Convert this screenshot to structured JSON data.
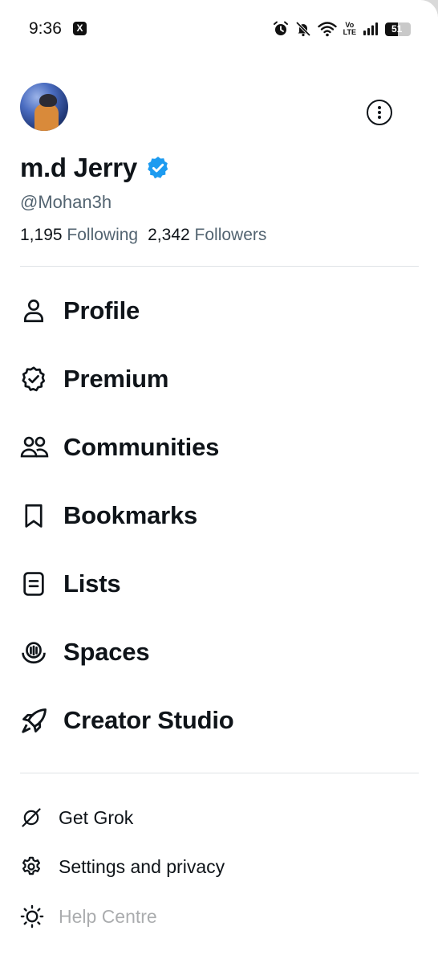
{
  "status_bar": {
    "time": "9:36",
    "app_badge": "X",
    "volte_top": "Vo",
    "volte_bottom": "LTE",
    "battery": "51",
    "battery_level": 0.51
  },
  "profile": {
    "display_name": "m.d Jerry",
    "handle": "@Mohan3h",
    "following_count": "1,195",
    "following_label": "Following",
    "followers_count": "2,342",
    "followers_label": "Followers",
    "verified_color": "#1d9bf0"
  },
  "menu": {
    "profile": "Profile",
    "premium": "Premium",
    "communities": "Communities",
    "bookmarks": "Bookmarks",
    "lists": "Lists",
    "spaces": "Spaces",
    "creator_studio": "Creator Studio"
  },
  "secondary": {
    "grok": "Get Grok",
    "settings": "Settings and privacy",
    "help": "Help Centre"
  },
  "icons": {
    "profile": "person-icon",
    "premium": "verified-badge-icon",
    "communities": "people-icon",
    "bookmarks": "bookmark-icon",
    "lists": "list-icon",
    "spaces": "microphone-icon",
    "creator_studio": "rocket-icon",
    "grok": "grok-icon",
    "settings": "gear-icon",
    "help": "sun-icon"
  }
}
